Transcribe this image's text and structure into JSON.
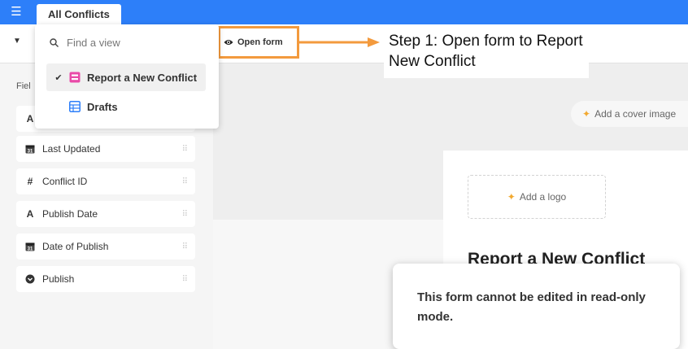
{
  "topbar": {
    "menu_icon": "hamburger-icon",
    "active_tab": "All Conflicts",
    "color": "#2d7ff9"
  },
  "toolbar": {
    "view_caret_icon": "caret-down-icon",
    "open_form_label": "Open form",
    "open_form_icon": "eye-icon"
  },
  "annotation": {
    "step_text": "Step 1: Open form to Report New Conflict",
    "highlight_color": "#f39a3d"
  },
  "view_switcher": {
    "search_placeholder": "Find a view",
    "items": [
      {
        "label": "Report a New Conflict",
        "icon": "form-view-icon",
        "selected": true,
        "icon_color": "#e94aa8"
      },
      {
        "label": "Drafts",
        "icon": "grid-view-icon",
        "selected": false,
        "icon_color": "#2d7ff9"
      }
    ]
  },
  "fields_panel": {
    "label": "Fiel",
    "items": [
      {
        "label": "",
        "icon_text": "A"
      },
      {
        "label": "Last Updated",
        "icon_text": "31"
      },
      {
        "label": "Conflict ID",
        "icon_text": "#"
      },
      {
        "label": "Publish Date",
        "icon_text": "A"
      },
      {
        "label": "Date of Publish",
        "icon_text": "31"
      },
      {
        "label": "Publish",
        "icon_text": "●"
      }
    ]
  },
  "form": {
    "cover_image_label": "Add a cover image",
    "logo_label": "Add a logo",
    "title": "Report a New Conflict",
    "readonly_message": "This form cannot be edited in read-only mode."
  }
}
